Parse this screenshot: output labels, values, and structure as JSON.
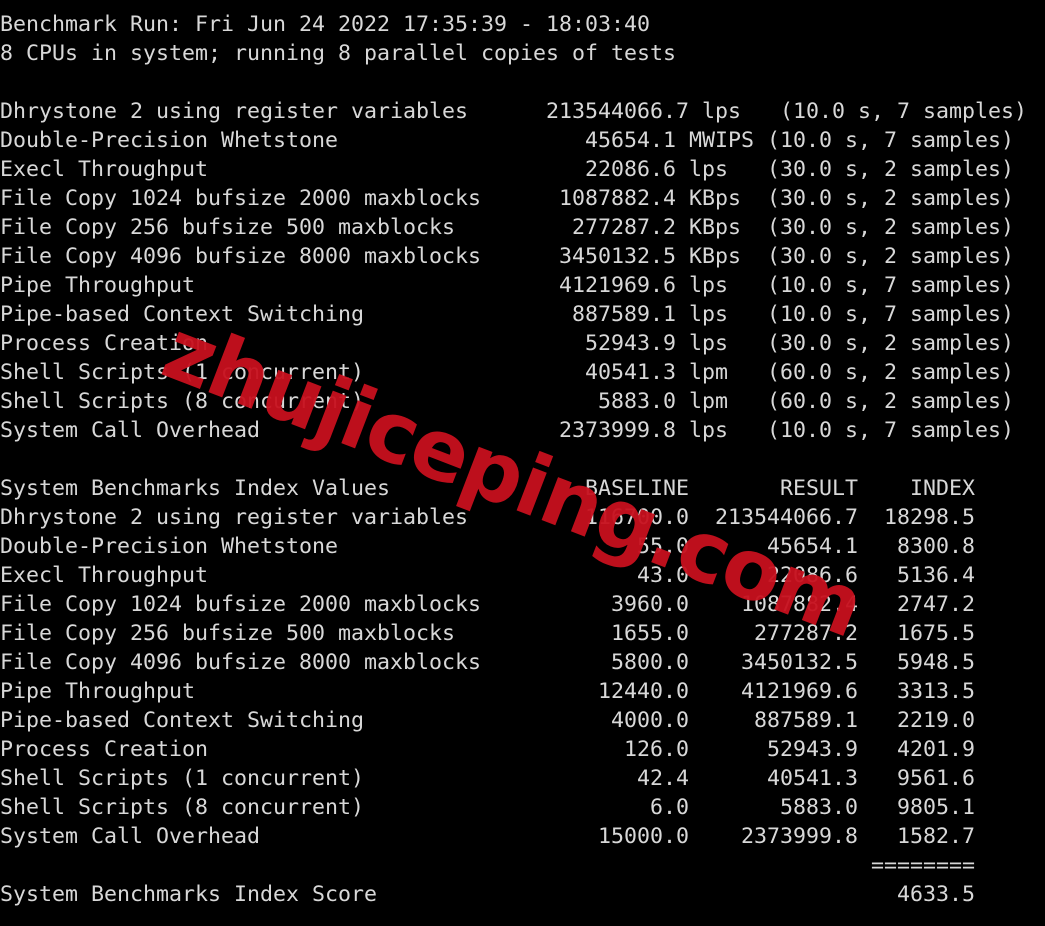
{
  "terminal": {
    "background_color": "#000000",
    "foreground_color": "#d8d8d8",
    "separator_top": "------------------------------------------------------------------------",
    "header": {
      "benchmark_run_line": "Benchmark Run: Fri Jun 24 2022 17:35:39 - 18:03:40",
      "cpu_line": "8 CPUs in system; running 8 parallel copies of tests"
    },
    "raw_results": {
      "rows": [
        {
          "name": "Dhrystone 2 using register variables",
          "value": "213544066.7",
          "unit": "lps",
          "duration": "10.0 s",
          "samples": "7 samples"
        },
        {
          "name": "Double-Precision Whetstone",
          "value": "45654.1",
          "unit": "MWIPS",
          "duration": "10.0 s",
          "samples": "7 samples"
        },
        {
          "name": "Execl Throughput",
          "value": "22086.6",
          "unit": "lps",
          "duration": "30.0 s",
          "samples": "2 samples"
        },
        {
          "name": "File Copy 1024 bufsize 2000 maxblocks",
          "value": "1087882.4",
          "unit": "KBps",
          "duration": "30.0 s",
          "samples": "2 samples"
        },
        {
          "name": "File Copy 256 bufsize 500 maxblocks",
          "value": "277287.2",
          "unit": "KBps",
          "duration": "30.0 s",
          "samples": "2 samples"
        },
        {
          "name": "File Copy 4096 bufsize 8000 maxblocks",
          "value": "3450132.5",
          "unit": "KBps",
          "duration": "30.0 s",
          "samples": "2 samples"
        },
        {
          "name": "Pipe Throughput",
          "value": "4121969.6",
          "unit": "lps",
          "duration": "10.0 s",
          "samples": "7 samples"
        },
        {
          "name": "Pipe-based Context Switching",
          "value": "887589.1",
          "unit": "lps",
          "duration": "10.0 s",
          "samples": "7 samples"
        },
        {
          "name": "Process Creation",
          "value": "52943.9",
          "unit": "lps",
          "duration": "30.0 s",
          "samples": "2 samples"
        },
        {
          "name": "Shell Scripts (1 concurrent)",
          "value": "40541.3",
          "unit": "lpm",
          "duration": "60.0 s",
          "samples": "2 samples"
        },
        {
          "name": "Shell Scripts (8 concurrent)",
          "value": "5883.0",
          "unit": "lpm",
          "duration": "60.0 s",
          "samples": "2 samples"
        },
        {
          "name": "System Call Overhead",
          "value": "2373999.8",
          "unit": "lps",
          "duration": "10.0 s",
          "samples": "7 samples"
        }
      ]
    },
    "index_values": {
      "title": "System Benchmarks Index Values",
      "columns": [
        "BASELINE",
        "RESULT",
        "INDEX"
      ],
      "rows": [
        {
          "name": "Dhrystone 2 using register variables",
          "baseline": "116700.0",
          "result": "213544066.7",
          "index": "18298.5"
        },
        {
          "name": "Double-Precision Whetstone",
          "baseline": "55.0",
          "result": "45654.1",
          "index": "8300.8"
        },
        {
          "name": "Execl Throughput",
          "baseline": "43.0",
          "result": "22086.6",
          "index": "5136.4"
        },
        {
          "name": "File Copy 1024 bufsize 2000 maxblocks",
          "baseline": "3960.0",
          "result": "1087882.4",
          "index": "2747.2"
        },
        {
          "name": "File Copy 256 bufsize 500 maxblocks",
          "baseline": "1655.0",
          "result": "277287.2",
          "index": "1675.5"
        },
        {
          "name": "File Copy 4096 bufsize 8000 maxblocks",
          "baseline": "5800.0",
          "result": "3450132.5",
          "index": "5948.5"
        },
        {
          "name": "Pipe Throughput",
          "baseline": "12440.0",
          "result": "4121969.6",
          "index": "3313.5"
        },
        {
          "name": "Pipe-based Context Switching",
          "baseline": "4000.0",
          "result": "887589.1",
          "index": "2219.0"
        },
        {
          "name": "Process Creation",
          "baseline": "126.0",
          "result": "52943.9",
          "index": "4201.9"
        },
        {
          "name": "Shell Scripts (1 concurrent)",
          "baseline": "42.4",
          "result": "40541.3",
          "index": "9561.6"
        },
        {
          "name": "Shell Scripts (8 concurrent)",
          "baseline": "6.0",
          "result": "5883.0",
          "index": "9805.1"
        },
        {
          "name": "System Call Overhead",
          "baseline": "15000.0",
          "result": "2373999.8",
          "index": "1582.7"
        }
      ],
      "separator_rule": "========",
      "score_label": "System Benchmarks Index Score",
      "score_value": "4633.5"
    },
    "rendered_text": "------------------------------------------------------------------------\nBenchmark Run: Fri Jun 24 2022 17:35:39 - 18:03:40\n8 CPUs in system; running 8 parallel copies of tests\n\nDhrystone 2 using register variables      213544066.7 lps   (10.0 s, 7 samples)\nDouble-Precision Whetstone                   45654.1 MWIPS (10.0 s, 7 samples)\nExecl Throughput                             22086.6 lps   (30.0 s, 2 samples)\nFile Copy 1024 bufsize 2000 maxblocks      1087882.4 KBps  (30.0 s, 2 samples)\nFile Copy 256 bufsize 500 maxblocks         277287.2 KBps  (30.0 s, 2 samples)\nFile Copy 4096 bufsize 8000 maxblocks      3450132.5 KBps  (30.0 s, 2 samples)\nPipe Throughput                            4121969.6 lps   (10.0 s, 7 samples)\nPipe-based Context Switching                887589.1 lps   (10.0 s, 7 samples)\nProcess Creation                             52943.9 lps   (30.0 s, 2 samples)\nShell Scripts (1 concurrent)                 40541.3 lpm   (60.0 s, 2 samples)\nShell Scripts (8 concurrent)                  5883.0 lpm   (60.0 s, 2 samples)\nSystem Call Overhead                       2373999.8 lps   (10.0 s, 7 samples)\n\nSystem Benchmarks Index Values               BASELINE       RESULT    INDEX\nDhrystone 2 using register variables         116700.0  213544066.7  18298.5\nDouble-Precision Whetstone                       55.0      45654.1   8300.8\nExecl Throughput                                 43.0      22086.6   5136.4\nFile Copy 1024 bufsize 2000 maxblocks          3960.0    1087882.4   2747.2\nFile Copy 256 bufsize 500 maxblocks            1655.0     277287.2   1675.5\nFile Copy 4096 bufsize 8000 maxblocks          5800.0    3450132.5   5948.5\nPipe Throughput                               12440.0    4121969.6   3313.5\nPipe-based Context Switching                   4000.0     887589.1   2219.0\nProcess Creation                                126.0      52943.9   4201.9\nShell Scripts (1 concurrent)                     42.4      40541.3   9561.6\nShell Scripts (8 concurrent)                      6.0       5883.0   9805.1\nSystem Call Overhead                          15000.0    2373999.8   1582.7\n                                                                   ========\nSystem Benchmarks Index Score                                        4633.5"
  },
  "watermark": {
    "text": "zhujiceping.com",
    "color": "#c8101e"
  }
}
